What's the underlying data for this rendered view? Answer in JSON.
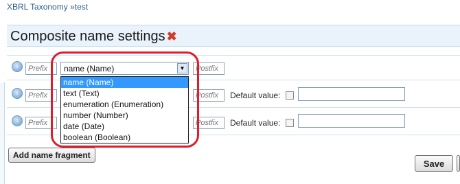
{
  "breadcrumb": {
    "root": "XBRL Taxonomy",
    "sep": "»",
    "current": "test"
  },
  "header": {
    "title": "Composite name settings",
    "close_glyph": "✖"
  },
  "rows": [
    {
      "prefix_placeholder": "Prefix",
      "postfix_placeholder": "Postfix",
      "selected": "name (Name)"
    },
    {
      "prefix_placeholder": "Prefix",
      "postfix_placeholder": "Postfix",
      "default_label": "Default value:"
    },
    {
      "prefix_placeholder": "Prefix",
      "postfix_placeholder": "Postfix",
      "default_label": "Default value:"
    }
  ],
  "dropdown": {
    "options": [
      "name (Name)",
      "text (Text)",
      "enumeration (Enumeration)",
      "number (Number)",
      "date (Date)",
      "boolean (Boolean)"
    ],
    "selected_index": 0
  },
  "buttons": {
    "add_fragment": "Add name fragment",
    "save": "Save"
  },
  "colors": {
    "highlight": "#e01b2b",
    "selection": "#3399ff",
    "link": "#2d5f8e"
  }
}
